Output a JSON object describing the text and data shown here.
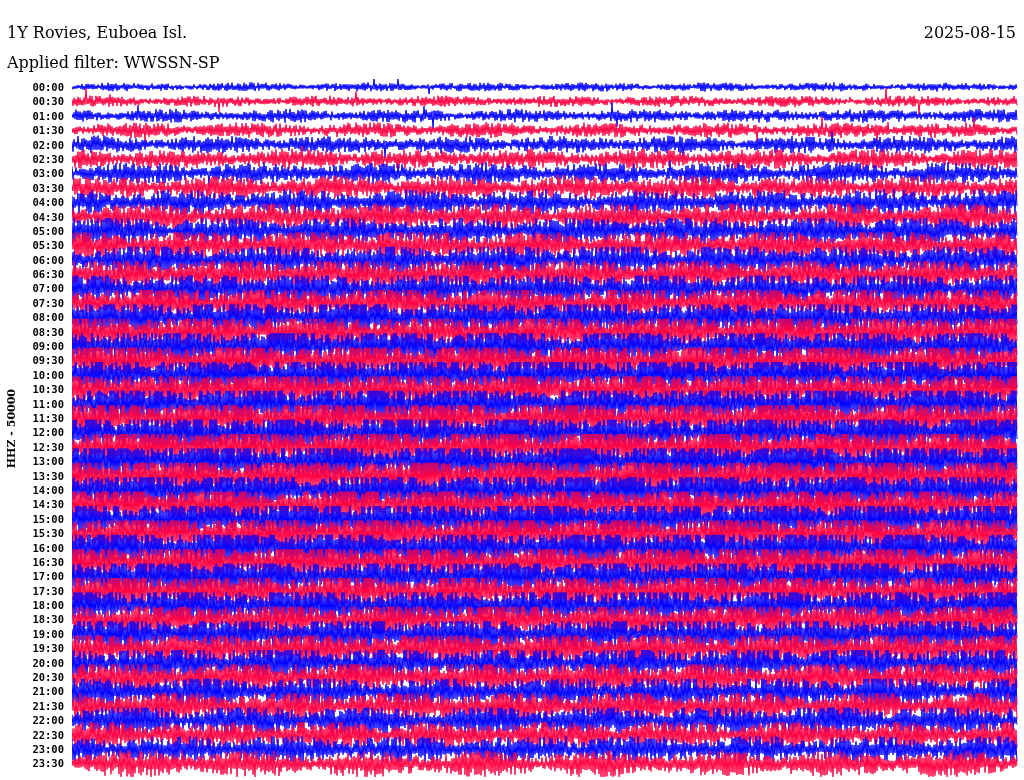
{
  "header": {
    "title": "1Y Rovies, Euboea Isl.",
    "date": "2025-08-15",
    "filter": "Applied filter: WWSSN-SP"
  },
  "axis_label": "HHZ - 50000",
  "traces": [
    {
      "label": "00:00",
      "color": "#0000ff"
    },
    {
      "label": "00:30",
      "color": "#ff0040"
    },
    {
      "label": "01:00",
      "color": "#0000ff"
    },
    {
      "label": "01:30",
      "color": "#ff0040"
    },
    {
      "label": "02:00",
      "color": "#0000ff"
    },
    {
      "label": "02:30",
      "color": "#ff0040"
    },
    {
      "label": "03:00",
      "color": "#0000ff"
    },
    {
      "label": "03:30",
      "color": "#ff0040"
    },
    {
      "label": "04:00",
      "color": "#0000ff"
    },
    {
      "label": "04:30",
      "color": "#ff0040"
    },
    {
      "label": "05:00",
      "color": "#0000ff"
    },
    {
      "label": "05:30",
      "color": "#ff0040"
    },
    {
      "label": "06:00",
      "color": "#0000ff"
    },
    {
      "label": "06:30",
      "color": "#ff0040"
    },
    {
      "label": "07:00",
      "color": "#0000ff"
    },
    {
      "label": "07:30",
      "color": "#ff0040"
    },
    {
      "label": "08:00",
      "color": "#0000ff"
    },
    {
      "label": "08:30",
      "color": "#ff0040"
    },
    {
      "label": "09:00",
      "color": "#0000ff"
    },
    {
      "label": "09:30",
      "color": "#ff0040"
    },
    {
      "label": "10:00",
      "color": "#0000ff"
    },
    {
      "label": "10:30",
      "color": "#ff0040"
    },
    {
      "label": "11:00",
      "color": "#0000ff"
    },
    {
      "label": "11:30",
      "color": "#ff0040"
    },
    {
      "label": "12:00",
      "color": "#0000ff"
    },
    {
      "label": "12:30",
      "color": "#ff0040"
    },
    {
      "label": "13:00",
      "color": "#0000ff"
    },
    {
      "label": "13:30",
      "color": "#ff0040"
    },
    {
      "label": "14:00",
      "color": "#0000ff"
    },
    {
      "label": "14:30",
      "color": "#ff0040"
    },
    {
      "label": "15:00",
      "color": "#0000ff"
    },
    {
      "label": "15:30",
      "color": "#ff0040"
    },
    {
      "label": "16:00",
      "color": "#0000ff"
    },
    {
      "label": "16:30",
      "color": "#ff0040"
    },
    {
      "label": "17:00",
      "color": "#0000ff"
    },
    {
      "label": "17:30",
      "color": "#ff0040"
    },
    {
      "label": "18:00",
      "color": "#0000ff"
    },
    {
      "label": "18:30",
      "color": "#ff0040"
    },
    {
      "label": "19:00",
      "color": "#0000ff"
    },
    {
      "label": "19:30",
      "color": "#ff0040"
    },
    {
      "label": "20:00",
      "color": "#0000ff"
    },
    {
      "label": "20:30",
      "color": "#ff0040"
    },
    {
      "label": "21:00",
      "color": "#0000ff"
    },
    {
      "label": "21:30",
      "color": "#ff0040"
    },
    {
      "label": "22:00",
      "color": "#0000ff"
    },
    {
      "label": "22:30",
      "color": "#ff0040"
    },
    {
      "label": "23:00",
      "color": "#0000ff"
    },
    {
      "label": "23:30",
      "color": "#ff0040"
    }
  ]
}
